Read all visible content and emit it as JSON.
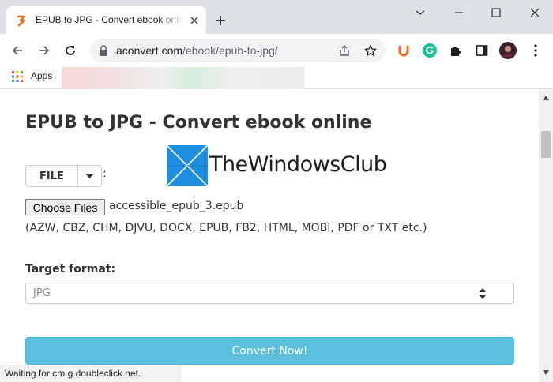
{
  "browser": {
    "tab": {
      "title": "EPUB to JPG - Convert ebook online"
    },
    "address_bar": {
      "url_host": "aconvert.com",
      "url_path": "/ebook/epub-to-jpg/"
    },
    "bookmarks": {
      "apps_label": "Apps"
    },
    "status_text": "Waiting for cm.g.doubleclick.net..."
  },
  "page": {
    "title": "EPUB to JPG - Convert ebook online",
    "file_button_label": "FILE",
    "file_colon": ":",
    "watermark_text": "TheWindowsClub",
    "choose_files_label": "Choose Files",
    "selected_file": "accessible_epub_3.epub",
    "supported_formats": "(AZW, CBZ, CHM, DJVU, DOCX, EPUB, FB2, HTML, MOBI, PDF or TXT etc.)",
    "target_format_label": "Target format:",
    "target_format_value": "JPG",
    "convert_button_label": "Convert Now!"
  },
  "colors": {
    "convert_button": "#5bc0de",
    "favicon": "#f26b21",
    "logo_blue": "#1e8fe0"
  },
  "icons": [
    "favicon-icon",
    "close-icon",
    "plus-icon",
    "minimize-icon",
    "maximize-icon",
    "window-close-icon",
    "back-icon",
    "forward-icon",
    "reload-icon",
    "lock-icon",
    "share-icon",
    "star-icon",
    "ublock-icon",
    "grammarly-icon",
    "puzzle-icon",
    "sidepanel-icon",
    "profile-avatar",
    "kebab-menu-icon",
    "apps-grid-icon",
    "caret-down-icon",
    "windows-logo-icon",
    "select-arrows-icon"
  ]
}
